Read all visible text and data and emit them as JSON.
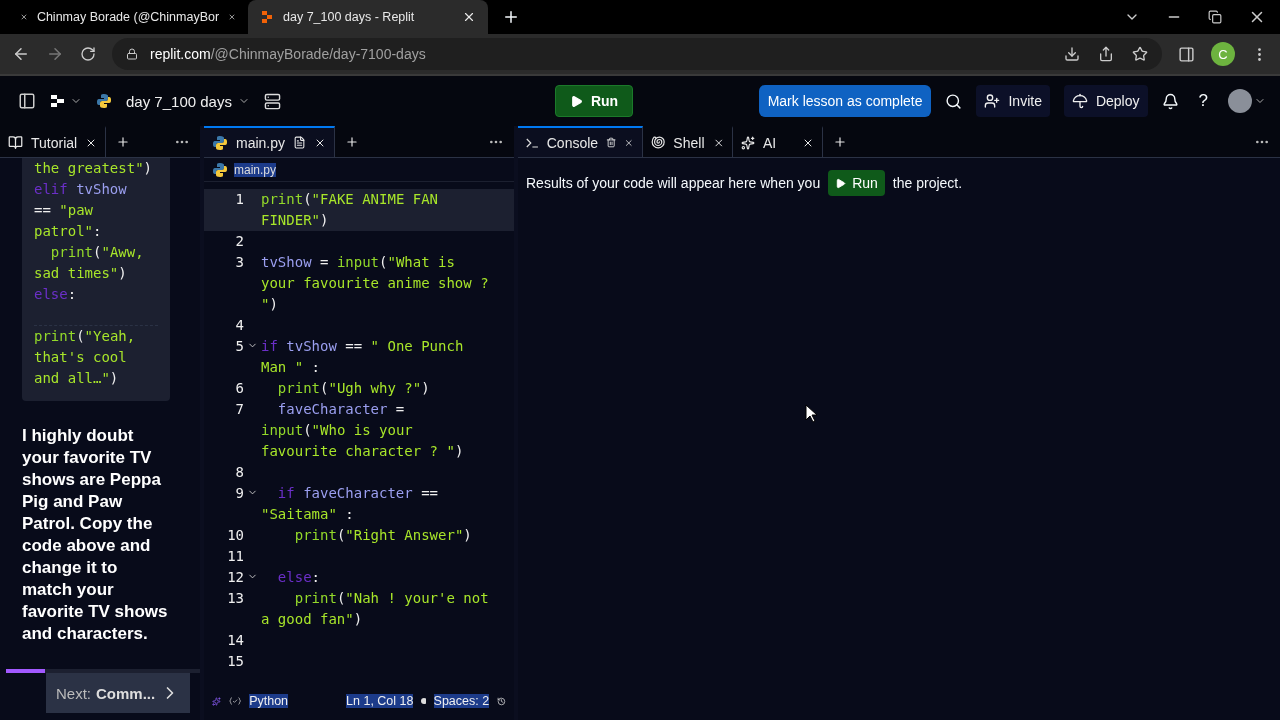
{
  "browser": {
    "tabs": [
      {
        "title": "Chinmay Borade (@ChinmayBor",
        "selected": false,
        "kind": "x"
      },
      {
        "title": "day 7_100 days - Replit",
        "selected": true,
        "kind": "replit"
      }
    ],
    "url_host": "replit.com",
    "url_path": "/@ChinmayBorade/day-7100-days",
    "profile_initial": "C"
  },
  "topbar": {
    "project": "day 7_100 days",
    "run": "Run",
    "mark_complete": "Mark lesson as complete",
    "invite": "Invite",
    "deploy": "Deploy",
    "help": "?"
  },
  "tutorial": {
    "tab": "Tutorial",
    "code": [
      {
        "segments": [
          {
            "kind": "str",
            "text": "the greatest\""
          },
          {
            "kind": "plain",
            "text": ")"
          }
        ]
      },
      {
        "segments": [
          {
            "kind": "kw",
            "text": "elif "
          },
          {
            "kind": "var",
            "text": "tvShow"
          }
        ]
      },
      {
        "segments": [
          {
            "kind": "plain",
            "text": "== "
          },
          {
            "kind": "str",
            "text": "\"paw"
          }
        ]
      },
      {
        "segments": [
          {
            "kind": "str",
            "text": "patrol\""
          },
          {
            "kind": "plain",
            "text": ":"
          }
        ]
      },
      {
        "segments": [
          {
            "kind": "fn",
            "text": "  print"
          },
          {
            "kind": "plain",
            "text": "("
          },
          {
            "kind": "str",
            "text": "\"Aww,"
          }
        ]
      },
      {
        "segments": [
          {
            "kind": "str",
            "text": "sad times\""
          },
          {
            "kind": "plain",
            "text": ")"
          }
        ]
      },
      {
        "gap_after": true,
        "segments": [
          {
            "kind": "kw",
            "text": "else"
          },
          {
            "kind": "plain",
            "text": ":"
          }
        ]
      },
      {
        "segments": [
          {
            "kind": "fn",
            "text": "print"
          },
          {
            "kind": "plain",
            "text": "("
          },
          {
            "kind": "str",
            "text": "\"Yeah,"
          }
        ]
      },
      {
        "segments": [
          {
            "kind": "str",
            "text": "that's cool"
          }
        ]
      },
      {
        "segments": [
          {
            "kind": "str",
            "text": "and all…\""
          },
          {
            "kind": "plain",
            "text": ")"
          }
        ]
      }
    ],
    "paragraph": "I highly doubt your favorite TV shows are Peppa Pig and Paw Patrol. Copy the code above and change it to match your favorite TV shows and characters.",
    "progress": {
      "level": 0.2
    },
    "next_label": "Next:",
    "next_title": "Comm..."
  },
  "editor": {
    "tab": "main.py",
    "breadcrumb": "main.py",
    "lines": [
      {
        "number": "1",
        "fold": false,
        "selected": true,
        "segments": [
          {
            "kind": "fn",
            "text": "print"
          },
          {
            "kind": "plain",
            "text": "("
          },
          {
            "kind": "str",
            "text": "\"FAKE ANIME FAN FINDER\""
          },
          {
            "kind": "plain",
            "text": ")"
          }
        ]
      },
      {
        "number": "2",
        "fold": false,
        "selected": false
      },
      {
        "number": "3",
        "fold": false,
        "selected": false,
        "segments": [
          {
            "kind": "var",
            "text": "tvShow"
          },
          {
            "kind": "plain",
            "text": " = "
          },
          {
            "kind": "fn",
            "text": "input"
          },
          {
            "kind": "plain",
            "text": "("
          },
          {
            "kind": "str",
            "text": "\"What is your favourite anime show ? \""
          },
          {
            "kind": "plain",
            "text": ")"
          }
        ]
      },
      {
        "number": "4",
        "fold": false,
        "selected": false
      },
      {
        "number": "5",
        "fold": true,
        "selected": false,
        "segments": [
          {
            "kind": "kw",
            "text": "if "
          },
          {
            "kind": "var",
            "text": "tvShow"
          },
          {
            "kind": "plain",
            "text": " == "
          },
          {
            "kind": "str",
            "text": "\" One Punch Man \""
          },
          {
            "kind": "plain",
            "text": " :"
          }
        ]
      },
      {
        "number": "6",
        "fold": false,
        "selected": false,
        "segments": [
          {
            "kind": "fn",
            "text": "  print"
          },
          {
            "kind": "plain",
            "text": "("
          },
          {
            "kind": "str",
            "text": "\"Ugh why ?\""
          },
          {
            "kind": "plain",
            "text": ")"
          }
        ]
      },
      {
        "number": "7",
        "fold": false,
        "selected": false,
        "segments": [
          {
            "kind": "var",
            "text": "  faveCharacter"
          },
          {
            "kind": "plain",
            "text": " = "
          },
          {
            "kind": "fn",
            "text": "input"
          },
          {
            "kind": "plain",
            "text": "("
          },
          {
            "kind": "str",
            "text": "\"Who is your favourite character ? \""
          },
          {
            "kind": "plain",
            "text": ")"
          }
        ]
      },
      {
        "number": "8",
        "fold": false,
        "selected": false
      },
      {
        "number": "9",
        "fold": true,
        "selected": false,
        "segments": [
          {
            "kind": "kw",
            "text": "  if "
          },
          {
            "kind": "var",
            "text": "faveCharacter"
          },
          {
            "kind": "plain",
            "text": " == "
          },
          {
            "kind": "str",
            "text": "\"Saitama\""
          },
          {
            "kind": "plain",
            "text": " :"
          }
        ]
      },
      {
        "number": "10",
        "fold": false,
        "selected": false,
        "segments": [
          {
            "kind": "fn",
            "text": "    print"
          },
          {
            "kind": "plain",
            "text": "("
          },
          {
            "kind": "str",
            "text": "\"Right Answer\""
          },
          {
            "kind": "plain",
            "text": ")"
          }
        ]
      },
      {
        "number": "11",
        "fold": false,
        "selected": false
      },
      {
        "number": "12",
        "fold": true,
        "selected": false,
        "segments": [
          {
            "kind": "kw",
            "text": "  else"
          },
          {
            "kind": "plain",
            "text": ":"
          }
        ]
      },
      {
        "number": "13",
        "fold": false,
        "selected": false,
        "segments": [
          {
            "kind": "fn",
            "text": "    print"
          },
          {
            "kind": "plain",
            "text": "("
          },
          {
            "kind": "str",
            "text": "\"Nah ! your'e not a good fan\""
          },
          {
            "kind": "plain",
            "text": ")"
          }
        ]
      },
      {
        "number": "14",
        "fold": false,
        "selected": false
      },
      {
        "number": "15",
        "fold": false,
        "selected": false
      }
    ],
    "status": {
      "language": "Python",
      "position": "Ln 1, Col 18",
      "spaces": "Spaces: 2"
    }
  },
  "console": {
    "tabs": [
      {
        "label": "Console",
        "kind": "console",
        "selected": true
      },
      {
        "label": "Shell",
        "kind": "shell",
        "selected": false
      },
      {
        "label": "AI",
        "kind": "ai",
        "selected": false
      }
    ],
    "message_before": "Results of your code will appear here when you",
    "run": "Run",
    "message_after": "the project."
  }
}
